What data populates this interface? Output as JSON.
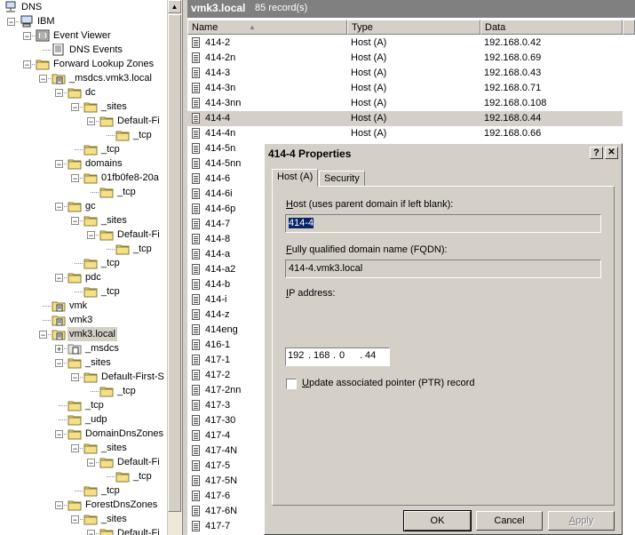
{
  "tree": {
    "items": [
      {
        "label": "DNS",
        "icon": "dns-server-icon"
      },
      {
        "label": "IBM",
        "icon": "computer-icon"
      },
      {
        "label": "Event Viewer",
        "icon": "event-viewer-icon"
      },
      {
        "label": "DNS Events",
        "icon": "event-log-icon"
      },
      {
        "label": "Forward Lookup Zones",
        "icon": "folder-icon"
      },
      {
        "label": "_msdcs.vmk3.local",
        "icon": "zone-icon"
      },
      {
        "label": "dc",
        "icon": "folder-icon"
      },
      {
        "label": "_sites",
        "icon": "folder-icon"
      },
      {
        "label": "Default-Fi",
        "icon": "folder-icon"
      },
      {
        "label": "_tcp",
        "icon": "folder-icon"
      },
      {
        "label": "_tcp",
        "icon": "folder-icon"
      },
      {
        "label": "domains",
        "icon": "folder-icon"
      },
      {
        "label": "01fb0fe8-20a",
        "icon": "folder-icon"
      },
      {
        "label": "_tcp",
        "icon": "folder-icon"
      },
      {
        "label": "gc",
        "icon": "folder-icon"
      },
      {
        "label": "_sites",
        "icon": "folder-icon"
      },
      {
        "label": "Default-Fi",
        "icon": "folder-icon"
      },
      {
        "label": "_tcp",
        "icon": "folder-icon"
      },
      {
        "label": "_tcp",
        "icon": "folder-icon"
      },
      {
        "label": "pdc",
        "icon": "folder-icon"
      },
      {
        "label": "_tcp",
        "icon": "folder-icon"
      },
      {
        "label": "vmk",
        "icon": "zone-icon"
      },
      {
        "label": "vmk3",
        "icon": "zone-icon"
      },
      {
        "label": "vmk3.local",
        "icon": "zone-icon"
      },
      {
        "label": "_msdcs",
        "icon": "delegated-zone-icon"
      },
      {
        "label": "_sites",
        "icon": "folder-icon"
      },
      {
        "label": "Default-First-S",
        "icon": "folder-icon"
      },
      {
        "label": "_tcp",
        "icon": "folder-icon"
      },
      {
        "label": "_tcp",
        "icon": "folder-icon"
      },
      {
        "label": "_udp",
        "icon": "folder-icon"
      },
      {
        "label": "DomainDnsZones",
        "icon": "folder-icon"
      },
      {
        "label": "_sites",
        "icon": "folder-icon"
      },
      {
        "label": "Default-Fi",
        "icon": "folder-icon"
      },
      {
        "label": "_tcp",
        "icon": "folder-icon"
      },
      {
        "label": "_tcp",
        "icon": "folder-icon"
      },
      {
        "label": "ForestDnsZones",
        "icon": "folder-icon"
      },
      {
        "label": "_sites",
        "icon": "folder-icon"
      },
      {
        "label": "Default-Fi",
        "icon": "folder-icon"
      }
    ]
  },
  "details": {
    "title": "vmk3.local",
    "count": "85 record(s)",
    "columns": [
      "Name",
      "Type",
      "Data"
    ],
    "sort_indicator": "▲",
    "rows": [
      {
        "name": "414-2",
        "type": "Host (A)",
        "data": "192.168.0.42"
      },
      {
        "name": "414-2n",
        "type": "Host (A)",
        "data": "192.168.0.69"
      },
      {
        "name": "414-3",
        "type": "Host (A)",
        "data": "192.168.0.43"
      },
      {
        "name": "414-3n",
        "type": "Host (A)",
        "data": "192.168.0.71"
      },
      {
        "name": "414-3nn",
        "type": "Host (A)",
        "data": "192.168.0.108"
      },
      {
        "name": "414-4",
        "type": "Host (A)",
        "data": "192.168.0.44"
      },
      {
        "name": "414-4n",
        "type": "Host (A)",
        "data": "192.168.0.66"
      },
      {
        "name": "414-5n",
        "type": "",
        "data": ""
      },
      {
        "name": "414-5nn",
        "type": "",
        "data": ""
      },
      {
        "name": "414-6",
        "type": "",
        "data": ""
      },
      {
        "name": "414-6i",
        "type": "",
        "data": ""
      },
      {
        "name": "414-6p",
        "type": "",
        "data": ""
      },
      {
        "name": "414-7",
        "type": "",
        "data": ""
      },
      {
        "name": "414-8",
        "type": "",
        "data": ""
      },
      {
        "name": "414-a",
        "type": "",
        "data": ""
      },
      {
        "name": "414-a2",
        "type": "",
        "data": ""
      },
      {
        "name": "414-b",
        "type": "",
        "data": ""
      },
      {
        "name": "414-i",
        "type": "",
        "data": ""
      },
      {
        "name": "414-z",
        "type": "",
        "data": ""
      },
      {
        "name": "414eng",
        "type": "",
        "data": ""
      },
      {
        "name": "416-1",
        "type": "",
        "data": ""
      },
      {
        "name": "417-1",
        "type": "",
        "data": ""
      },
      {
        "name": "417-2",
        "type": "",
        "data": ""
      },
      {
        "name": "417-2nn",
        "type": "",
        "data": ""
      },
      {
        "name": "417-3",
        "type": "",
        "data": ""
      },
      {
        "name": "417-30",
        "type": "",
        "data": ""
      },
      {
        "name": "417-4",
        "type": "",
        "data": ""
      },
      {
        "name": "417-4N",
        "type": "",
        "data": ""
      },
      {
        "name": "417-5",
        "type": "",
        "data": ""
      },
      {
        "name": "417-5N",
        "type": "",
        "data": ""
      },
      {
        "name": "417-6",
        "type": "",
        "data": ""
      },
      {
        "name": "417-6N",
        "type": "",
        "data": ""
      },
      {
        "name": "417-7",
        "type": "",
        "data": ""
      }
    ]
  },
  "dialog": {
    "title": "414-4 Properties",
    "help_label": "?",
    "close_label": "✕",
    "tabs": [
      "Host (A)",
      "Security"
    ],
    "host_label": "Host (uses parent domain if left blank):",
    "host_value": "414-4",
    "fqdn_label": "Fully qualified domain name (FQDN):",
    "fqdn_value": "414-4.vmk3.local",
    "ip_label": "IP address:",
    "ip_octets": [
      "192",
      "168",
      "0",
      "44"
    ],
    "ptr_label": "Update associated pointer (PTR) record",
    "ptr_checked": false,
    "ok_label": "OK",
    "cancel_label": "Cancel",
    "apply_label": "Apply"
  }
}
